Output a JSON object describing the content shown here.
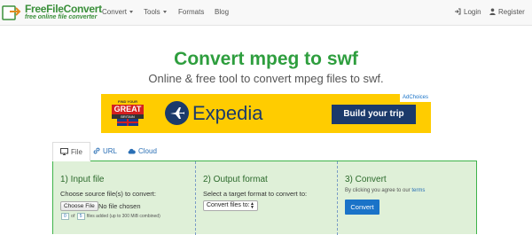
{
  "brand": {
    "name": "FreeFileConvert",
    "tagline": "free online file converter"
  },
  "nav": {
    "items": [
      {
        "label": "Convert",
        "has_caret": true
      },
      {
        "label": "Tools",
        "has_caret": true
      },
      {
        "label": "Formats",
        "has_caret": false
      },
      {
        "label": "Blog",
        "has_caret": false
      }
    ],
    "login_label": "Login",
    "login_icon": "sign-in-icon",
    "register_label": "Register",
    "register_icon": "user-icon"
  },
  "hero": {
    "title": "Convert mpeg to swf",
    "subtitle": "Online & free tool to convert mpeg files to swf."
  },
  "ad": {
    "flag_top": "FIND YOUR",
    "flag_main": "GREAT",
    "flag_sub": "BRITAIN",
    "brand": "Expedia",
    "cta": "Build your trip",
    "choices": "AdChoices",
    "background": "#ffcc00",
    "brand_color": "#1b3a6b"
  },
  "tabs": [
    {
      "label": "File",
      "icon": "monitor-icon",
      "active": true
    },
    {
      "label": "URL",
      "icon": "link-icon",
      "active": false
    },
    {
      "label": "Cloud",
      "icon": "cloud-icon",
      "active": false
    }
  ],
  "steps": {
    "input": {
      "title": "1) Input file",
      "description": "Choose source file(s) to convert:",
      "choose_button": "Choose File",
      "no_file": "No file chosen",
      "files_added": "0",
      "files_total": "5",
      "of_label": "of",
      "files_suffix": "files added (up to 300 MiB combined)"
    },
    "output": {
      "title": "2) Output format",
      "description": "Select a target format to convert to:",
      "select_value": "Convert files to:"
    },
    "convert": {
      "title": "3) Convert",
      "agree_text": "By clicking you agree to our",
      "terms_link": "terms",
      "button": "Convert"
    }
  },
  "colors": {
    "accent_green": "#2e9e3e",
    "panel_bg": "#dff0d8",
    "panel_border": "#3eb34a",
    "link_blue": "#2a6fb5",
    "button_blue": "#1a73c8"
  }
}
